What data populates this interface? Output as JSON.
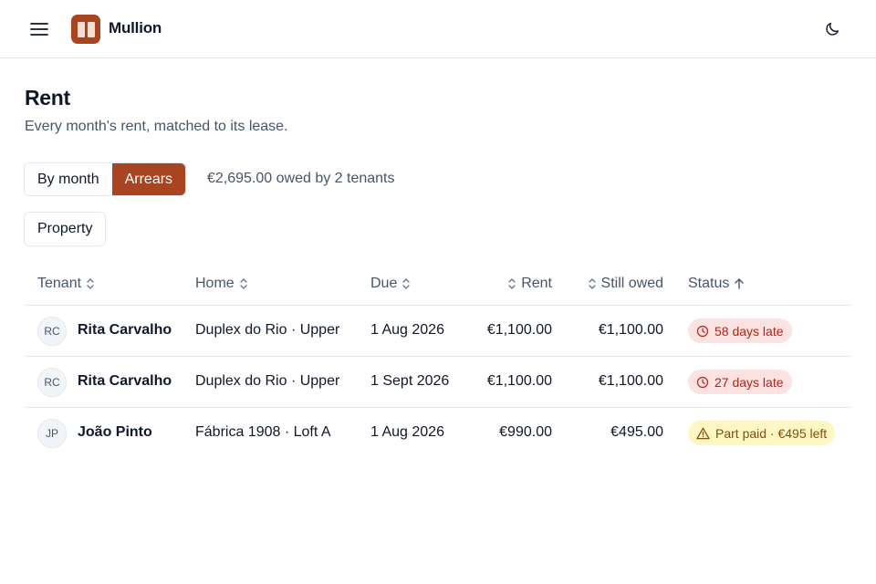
{
  "header": {
    "menu_icon": "hamburger-menu-icon",
    "brand_name": "Mullion",
    "theme_icon": "moon-icon"
  },
  "page": {
    "title": "Rent",
    "subtitle": "Every month's rent, matched to its lease."
  },
  "view_toggle": {
    "options": [
      "By month",
      "Arrears"
    ],
    "selected": "Arrears",
    "summary": "€2,695.00 owed by 2 tenants"
  },
  "filters": {
    "property_label": "Property"
  },
  "table": {
    "columns": {
      "tenant": "Tenant",
      "home": "Home",
      "due": "Due",
      "rent": "Rent",
      "still_owed": "Still owed",
      "status": "Status"
    },
    "sort": {
      "column": "Status",
      "direction": "ascending"
    },
    "rows": [
      {
        "initials": "RC",
        "tenant": "Rita Carvalho",
        "home": "Duplex do Rio · Upper",
        "due": "1 Aug 2026",
        "rent": "€1,100.00",
        "still_owed": "€1,100.00",
        "status": "58 days late",
        "status_type": "late",
        "status_icon": "clock-icon"
      },
      {
        "initials": "RC",
        "tenant": "Rita Carvalho",
        "home": "Duplex do Rio · Upper",
        "due": "1 Sept 2026",
        "rent": "€1,100.00",
        "still_owed": "€1,100.00",
        "status": "27 days late",
        "status_type": "late",
        "status_icon": "clock-icon"
      },
      {
        "initials": "JP",
        "tenant": "João Pinto",
        "home": "Fábrica 1908 · Loft A",
        "due": "1 Aug 2026",
        "rent": "€990.00",
        "still_owed": "€495.00",
        "status": "Part paid · €495 left",
        "status_type": "partial",
        "status_icon": "warning-triangle-icon"
      }
    ]
  },
  "colors": {
    "brand": "#a8441f",
    "late_bg": "#fde2e2",
    "late_text": "#b42318",
    "partial_bg": "#fef7c3",
    "partial_text": "#854d0e"
  }
}
